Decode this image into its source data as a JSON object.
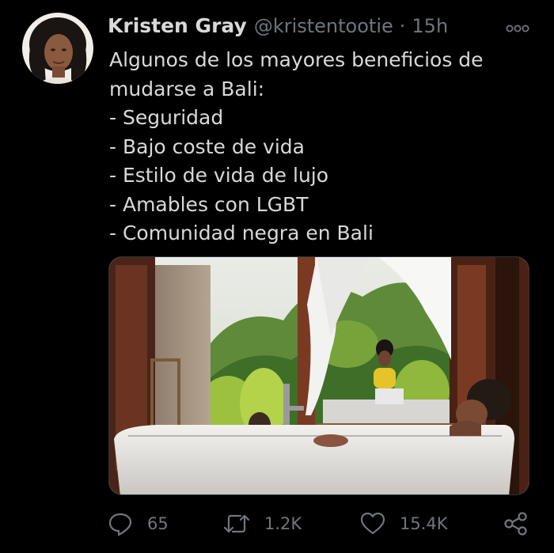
{
  "tweet": {
    "author": {
      "display_name": "Kristen Gray",
      "handle": "@kristentootie",
      "separator": "·",
      "time": "15h"
    },
    "text_lines": [
      "Algunos de los mayores beneficios de",
      "mudarse a Bali:",
      "- Seguridad",
      "- Bajo coste de vida",
      "- Estilo de vida de lujo",
      "- Amables con LGBT",
      "- Comunidad negra en Bali"
    ],
    "actions": {
      "reply_count": "65",
      "retweet_count": "1.2K",
      "like_count": "15.4K"
    }
  },
  "colors": {
    "background": "#000000",
    "primary_text": "#d9d9d9",
    "secondary_text": "#6e767d",
    "border": "#2f3336"
  },
  "icons": {
    "more": "more-horizontal-icon",
    "reply": "reply-icon",
    "retweet": "retweet-icon",
    "like": "heart-icon",
    "share": "share-icon"
  }
}
